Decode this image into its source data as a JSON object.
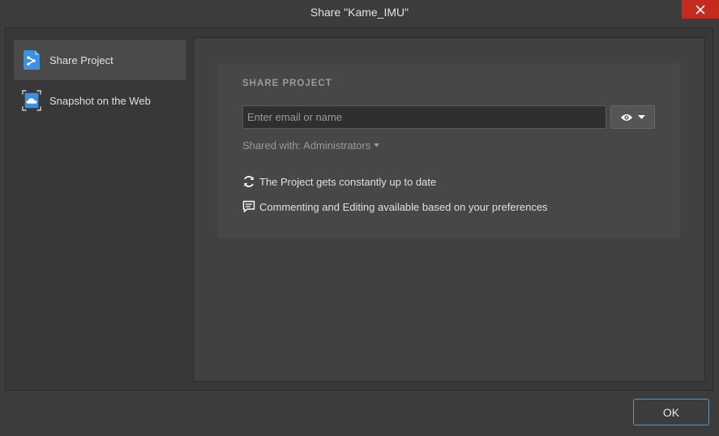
{
  "window": {
    "title": "Share \"Kame_IMU\"",
    "close_icon": "close-icon"
  },
  "sidebar": {
    "items": [
      {
        "label": "Share Project",
        "icon": "share-project-icon",
        "active": true
      },
      {
        "label": "Snapshot on the Web",
        "icon": "snapshot-cloud-icon",
        "active": false
      }
    ]
  },
  "share": {
    "heading": "SHARE PROJECT",
    "email_placeholder": "Enter email or name",
    "email_value": "",
    "permission_icon": "eye-icon",
    "shared_with": "Shared with: Administrators",
    "features": [
      {
        "icon": "sync-icon",
        "text": "The Project gets constantly up to date"
      },
      {
        "icon": "comment-icon",
        "text": "Commenting and Editing available based on your preferences"
      }
    ]
  },
  "footer": {
    "ok_label": "OK"
  },
  "colors": {
    "accent": "#4a90d9",
    "close_red": "#c42b1c",
    "background": "#3c3c3c",
    "panel": "#414141",
    "card": "#474747"
  }
}
